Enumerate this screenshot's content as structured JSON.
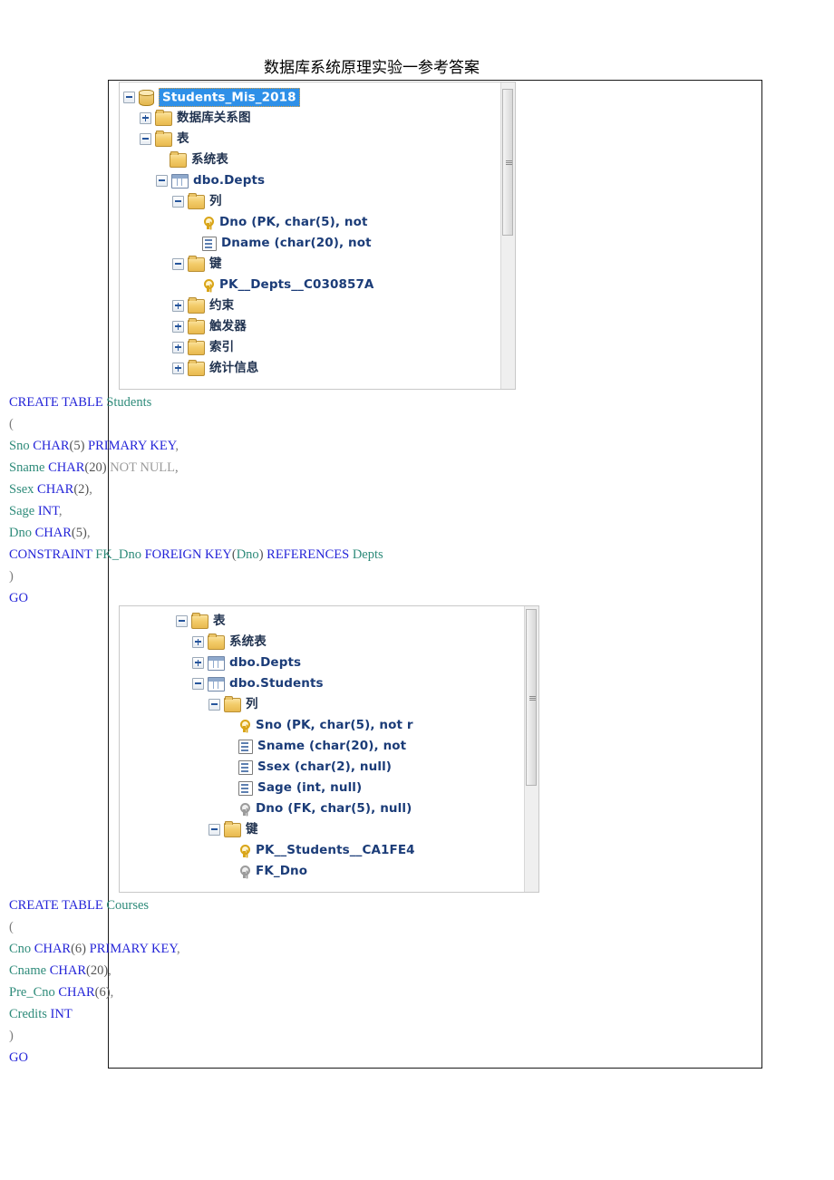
{
  "document": {
    "header_title": "数据库系统原理实验一参考答案"
  },
  "tree_one": {
    "name": "object-explorer-depts",
    "scroll": {
      "thumb_top_pct": 2,
      "thumb_height_pct": 48
    },
    "rows": [
      {
        "indent": 0,
        "expander": "minus",
        "icon": "db-icon",
        "label": "Students_Mis_2018",
        "selected": true,
        "cjk": false
      },
      {
        "indent": 1,
        "expander": "plus",
        "icon": "folder-icon",
        "label": "数据库关系图",
        "selected": false,
        "cjk": true
      },
      {
        "indent": 1,
        "expander": "minus",
        "icon": "folder-icon",
        "label": "表",
        "selected": false,
        "cjk": true
      },
      {
        "indent": 2,
        "expander": "none",
        "icon": "folder-icon",
        "label": "系统表",
        "selected": false,
        "cjk": true
      },
      {
        "indent": 2,
        "expander": "minus",
        "icon": "table-icon",
        "label": "dbo.Depts",
        "selected": false,
        "cjk": false
      },
      {
        "indent": 3,
        "expander": "minus",
        "icon": "folder-icon",
        "label": "列",
        "selected": false,
        "cjk": true
      },
      {
        "indent": 4,
        "expander": "none",
        "icon": "key-icon",
        "label": "Dno (PK, char(5), not",
        "selected": false,
        "cjk": false
      },
      {
        "indent": 4,
        "expander": "none",
        "icon": "column-icon",
        "label": "Dname (char(20), not",
        "selected": false,
        "cjk": false
      },
      {
        "indent": 3,
        "expander": "minus",
        "icon": "folder-icon",
        "label": "键",
        "selected": false,
        "cjk": true
      },
      {
        "indent": 4,
        "expander": "none",
        "icon": "key-icon",
        "label": "PK__Depts__C030857A",
        "selected": false,
        "cjk": false
      },
      {
        "indent": 3,
        "expander": "plus",
        "icon": "folder-icon",
        "label": "约束",
        "selected": false,
        "cjk": true
      },
      {
        "indent": 3,
        "expander": "plus",
        "icon": "folder-icon",
        "label": "触发器",
        "selected": false,
        "cjk": true
      },
      {
        "indent": 3,
        "expander": "plus",
        "icon": "folder-icon",
        "label": "索引",
        "selected": false,
        "cjk": true
      },
      {
        "indent": 3,
        "expander": "plus",
        "icon": "folder-icon",
        "label": "统计信息",
        "selected": false,
        "cjk": true
      }
    ]
  },
  "sql_students": {
    "name": "create-table-students",
    "lines": [
      [
        {
          "t": "CREATE TABLE ",
          "c": "kw"
        },
        {
          "t": "Students",
          "c": "idn"
        }
      ],
      [
        {
          "t": "(",
          "c": "pun"
        }
      ],
      [
        {
          "t": "Sno ",
          "c": "idn"
        },
        {
          "t": "CHAR",
          "c": "kw"
        },
        {
          "t": "(5)",
          "c": "num"
        },
        {
          "t": " PRIMARY KEY",
          "c": "kw"
        },
        {
          "t": ",",
          "c": "pun"
        }
      ],
      [
        {
          "t": "Sname ",
          "c": "idn"
        },
        {
          "t": "CHAR",
          "c": "kw"
        },
        {
          "t": "(20)",
          "c": "num"
        },
        {
          "t": " NOT NULL",
          "c": "nul"
        },
        {
          "t": ",",
          "c": "pun"
        }
      ],
      [
        {
          "t": "Ssex ",
          "c": "idn"
        },
        {
          "t": "CHAR",
          "c": "kw"
        },
        {
          "t": "(2)",
          "c": "num"
        },
        {
          "t": ",",
          "c": "pun"
        }
      ],
      [
        {
          "t": "Sage ",
          "c": "idn"
        },
        {
          "t": "INT",
          "c": "kw"
        },
        {
          "t": ",",
          "c": "pun"
        }
      ],
      [
        {
          "t": "Dno ",
          "c": "idn"
        },
        {
          "t": "CHAR",
          "c": "kw"
        },
        {
          "t": "(5)",
          "c": "num"
        },
        {
          "t": ",",
          "c": "pun"
        }
      ],
      [
        {
          "t": "CONSTRAINT ",
          "c": "kw"
        },
        {
          "t": " FK_Dno ",
          "c": "idn"
        },
        {
          "t": "FOREIGN KEY",
          "c": "kw"
        },
        {
          "t": "(",
          "c": "num"
        },
        {
          "t": "Dno",
          "c": "idn"
        },
        {
          "t": ")",
          "c": "num"
        },
        {
          "t": " REFERENCES ",
          "c": "kw"
        },
        {
          "t": "Depts",
          "c": "idn"
        }
      ],
      [
        {
          "t": ")",
          "c": "pun"
        }
      ],
      [
        {
          "t": "GO",
          "c": "kw"
        }
      ]
    ]
  },
  "tree_two": {
    "name": "object-explorer-students",
    "scroll": {
      "thumb_top_pct": 1,
      "thumb_height_pct": 62
    },
    "rows": [
      {
        "indent": 0,
        "expander": "minus",
        "icon": "folder-icon",
        "label": "表",
        "selected": false,
        "cjk": true
      },
      {
        "indent": 1,
        "expander": "plus",
        "icon": "folder-icon",
        "label": "系统表",
        "selected": false,
        "cjk": true
      },
      {
        "indent": 1,
        "expander": "plus",
        "icon": "table-icon",
        "label": "dbo.Depts",
        "selected": false,
        "cjk": false
      },
      {
        "indent": 1,
        "expander": "minus",
        "icon": "table-icon",
        "label": "dbo.Students",
        "selected": false,
        "cjk": false
      },
      {
        "indent": 2,
        "expander": "minus",
        "icon": "folder-icon",
        "label": "列",
        "selected": false,
        "cjk": true
      },
      {
        "indent": 3,
        "expander": "none",
        "icon": "key-icon",
        "label": "Sno (PK, char(5), not r",
        "selected": false,
        "cjk": false
      },
      {
        "indent": 3,
        "expander": "none",
        "icon": "column-icon",
        "label": "Sname (char(20), not",
        "selected": false,
        "cjk": false
      },
      {
        "indent": 3,
        "expander": "none",
        "icon": "column-icon",
        "label": "Ssex (char(2), null)",
        "selected": false,
        "cjk": false
      },
      {
        "indent": 3,
        "expander": "none",
        "icon": "column-icon",
        "label": "Sage (int, null)",
        "selected": false,
        "cjk": false
      },
      {
        "indent": 3,
        "expander": "none",
        "icon": "keyfk-icon",
        "label": "Dno (FK, char(5), null)",
        "selected": false,
        "cjk": false
      },
      {
        "indent": 2,
        "expander": "minus",
        "icon": "folder-icon",
        "label": "键",
        "selected": false,
        "cjk": true
      },
      {
        "indent": 3,
        "expander": "none",
        "icon": "key-icon",
        "label": "PK__Students__CA1FE4",
        "selected": false,
        "cjk": false
      },
      {
        "indent": 3,
        "expander": "none",
        "icon": "keyfk-icon",
        "label": "FK_Dno",
        "selected": false,
        "cjk": false
      }
    ]
  },
  "sql_courses": {
    "name": "create-table-courses",
    "lines": [
      [
        {
          "t": "CREATE TABLE ",
          "c": "kw"
        },
        {
          "t": "Courses",
          "c": "idn"
        }
      ],
      [
        {
          "t": "(",
          "c": "pun"
        }
      ],
      [
        {
          "t": "Cno ",
          "c": "idn"
        },
        {
          "t": "CHAR",
          "c": "kw"
        },
        {
          "t": "(6)",
          "c": "num"
        },
        {
          "t": " PRIMARY KEY",
          "c": "kw"
        },
        {
          "t": ",",
          "c": "pun"
        }
      ],
      [
        {
          "t": "Cname ",
          "c": "idn"
        },
        {
          "t": "CHAR",
          "c": "kw"
        },
        {
          "t": "(20)",
          "c": "num"
        },
        {
          "t": ",",
          "c": "pun"
        }
      ],
      [
        {
          "t": "Pre_Cno ",
          "c": "idn"
        },
        {
          "t": "CHAR",
          "c": "kw"
        },
        {
          "t": "(6)",
          "c": "num"
        },
        {
          "t": ",",
          "c": "pun"
        }
      ],
      [
        {
          "t": "Credits ",
          "c": "idn"
        },
        {
          "t": "INT",
          "c": "kw"
        }
      ],
      [
        {
          "t": ")",
          "c": "pun"
        }
      ],
      [
        {
          "t": "GO",
          "c": "kw"
        }
      ]
    ]
  },
  "colors": {
    "selection_blue": "#2e90e8",
    "tree_text": "#1b3c78",
    "sql_keyword": "#2424d8",
    "sql_identifier": "#2e8b7a",
    "folder_gold": "#e8b94f"
  }
}
